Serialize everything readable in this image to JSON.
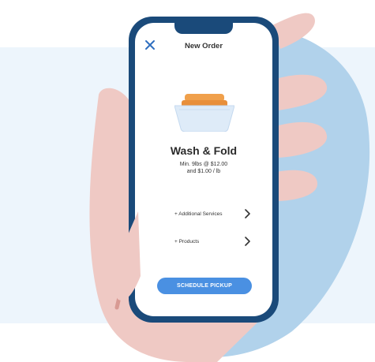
{
  "header": {
    "title": "New Order"
  },
  "icons": {
    "close": "close-x-icon",
    "basket": "laundry-basket-icon",
    "chevron": "chevron-right-icon"
  },
  "service": {
    "title": "Wash & Fold",
    "price_line1": "Min. 9lbs @ $12.00",
    "price_line2": "and $1.00 / lb"
  },
  "options": [
    {
      "label": "+ Additional Services"
    },
    {
      "label": "+ Products"
    }
  ],
  "actions": {
    "schedule_label": "SCHEDULE PICKUP"
  },
  "colors": {
    "accent": "#4a90e2",
    "phone_frame": "#1a4a7a",
    "close_icon": "#2f6fc0",
    "blob": "#b1d2eb",
    "band": "#edf5fc",
    "skin": "#efc9c4",
    "basket_orange": "#f0a04b",
    "basket_body": "#deebf8"
  }
}
